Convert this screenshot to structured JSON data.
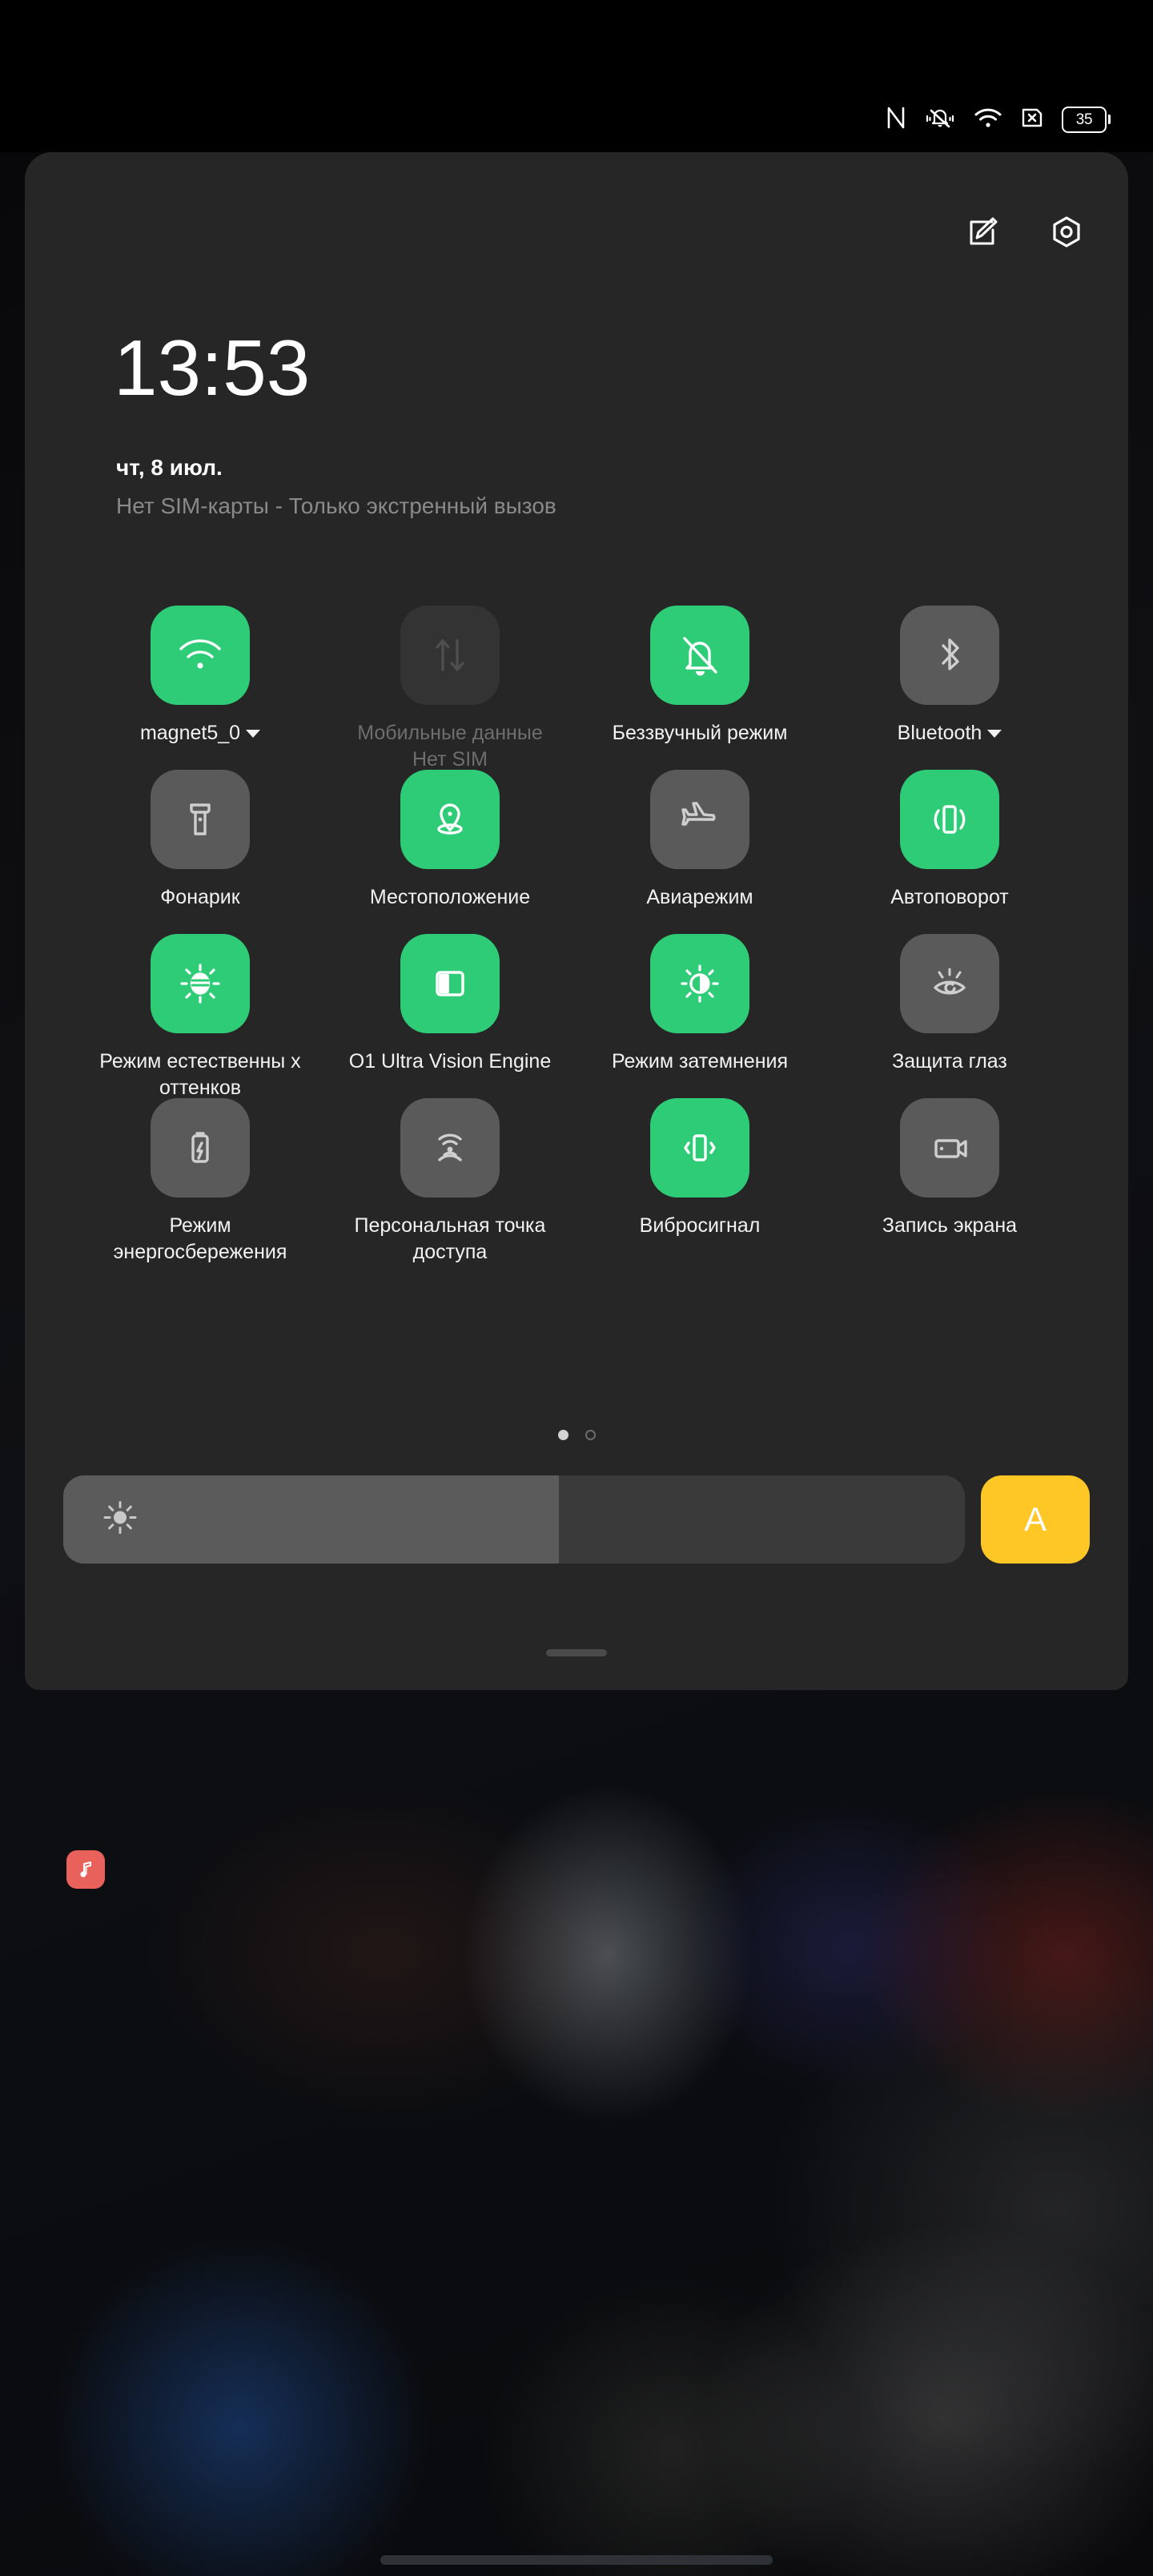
{
  "statusbar": {
    "icons": [
      {
        "name": "nfc-icon",
        "glyph": "N"
      },
      {
        "name": "silent-bell-icon",
        "glyph": "bell-slash"
      },
      {
        "name": "wifi-icon",
        "glyph": "wifi"
      },
      {
        "name": "no-sim-icon",
        "glyph": "sim-x"
      }
    ],
    "battery_level": "35"
  },
  "panel": {
    "header": {
      "edit_label": "edit-tiles",
      "settings_label": "settings"
    },
    "clock": "13:53",
    "date": "чт, 8 июл.",
    "carrier_status": "Нет SIM-карты - Только экстренный вызов"
  },
  "tiles": [
    {
      "id": "wifi",
      "label": "magnet5_0",
      "sub": "",
      "state": "on",
      "icon": "wifi-icon",
      "caret": true
    },
    {
      "id": "mobile-data",
      "label": "Мобильные данные",
      "sub": "Нет SIM",
      "state": "disabled",
      "icon": "data-transfer-icon",
      "caret": false
    },
    {
      "id": "silent-mode",
      "label": "Беззвучный режим",
      "sub": "",
      "state": "on",
      "icon": "bell-slash-icon",
      "caret": false
    },
    {
      "id": "bluetooth",
      "label": "Bluetooth",
      "sub": "",
      "state": "off",
      "icon": "bluetooth-icon",
      "caret": true
    },
    {
      "id": "flashlight",
      "label": "Фонарик",
      "sub": "",
      "state": "off",
      "icon": "flashlight-icon",
      "caret": false
    },
    {
      "id": "location",
      "label": "Местоположение",
      "sub": "",
      "state": "on",
      "icon": "location-pin-icon",
      "caret": false
    },
    {
      "id": "airplane-mode",
      "label": "Авиарежим",
      "sub": "",
      "state": "off",
      "icon": "airplane-icon",
      "caret": false
    },
    {
      "id": "auto-rotate",
      "label": "Автоповорот",
      "sub": "",
      "state": "on",
      "icon": "auto-rotate-icon",
      "caret": false
    },
    {
      "id": "natural-tone",
      "label": "Режим естественны х оттенков",
      "sub": "",
      "state": "on",
      "icon": "sun-stripes-icon",
      "caret": false
    },
    {
      "id": "o1-ultra-vision",
      "label": "O1 Ultra Vision Engine",
      "sub": "",
      "state": "on",
      "icon": "split-screen-icon",
      "caret": false
    },
    {
      "id": "dimming-mode",
      "label": "Режим затемнения",
      "sub": "",
      "state": "on",
      "icon": "half-sun-icon",
      "caret": false
    },
    {
      "id": "eye-protection",
      "label": "Защита глаз",
      "sub": "",
      "state": "off",
      "icon": "eye-icon",
      "caret": false
    },
    {
      "id": "battery-saver",
      "label": "Режим энергосбережения",
      "sub": "",
      "state": "off",
      "icon": "battery-bolt-icon",
      "caret": false
    },
    {
      "id": "hotspot",
      "label": "Персональная точка доступа",
      "sub": "",
      "state": "off",
      "icon": "hotspot-icon",
      "caret": false
    },
    {
      "id": "vibrate",
      "label": "Вибросигнал",
      "sub": "",
      "state": "on",
      "icon": "vibrate-icon",
      "caret": false
    },
    {
      "id": "screen-record",
      "label": "Запись экрана",
      "sub": "",
      "state": "off",
      "icon": "camcorder-icon",
      "caret": false
    }
  ],
  "pagination": {
    "total_pages": 2,
    "current_page": 1
  },
  "brightness": {
    "icon": "brightness-sun-icon",
    "value_percent": 55,
    "auto_label": "A"
  },
  "footer": {
    "drag_handle": "panel-drag-handle"
  },
  "notification_area": {
    "app_icon": "music-note-icon"
  },
  "colors": {
    "tile_on": "#2ECC77",
    "tile_off": "#5a5a5a",
    "tile_disabled": "#333333",
    "auto_brightness": "#FFC726",
    "panel_bg": "#262626",
    "music_app": "#E8615A"
  }
}
